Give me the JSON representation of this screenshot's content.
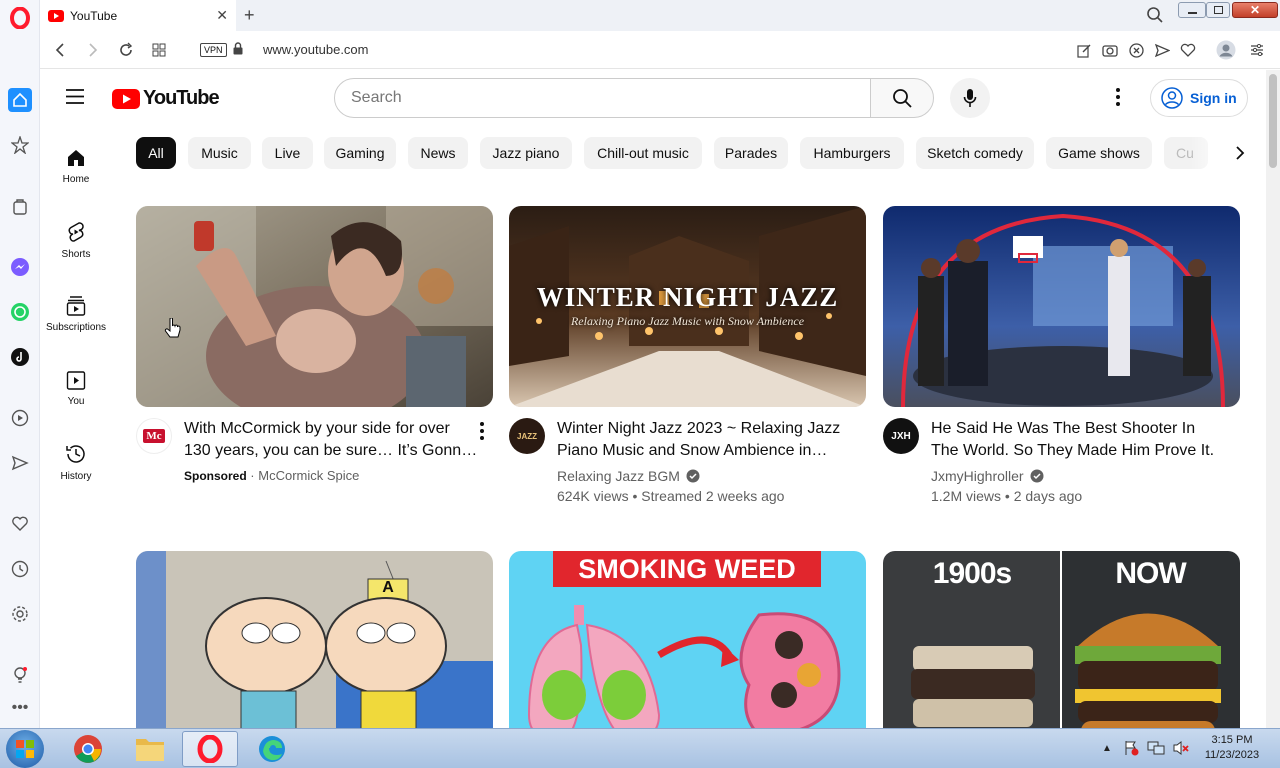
{
  "browser": {
    "tab_title": "YouTube",
    "url": "www.youtube.com",
    "vpn_label": "VPN"
  },
  "youtube": {
    "logo_text": "YouTube",
    "search_placeholder": "Search",
    "sign_in": "Sign in",
    "chips": [
      "All",
      "Music",
      "Live",
      "Gaming",
      "News",
      "Jazz piano",
      "Chill-out music",
      "Parades",
      "Hamburgers",
      "Sketch comedy",
      "Game shows",
      "Cu"
    ],
    "guide": [
      "Home",
      "Shorts",
      "Subscriptions",
      "You",
      "History"
    ],
    "videos": [
      {
        "title_1": "With McCormick by your side for over",
        "title_2": "130 years, you can be sure… It’s Gonn…",
        "sponsored": "Sponsored",
        "channel": "McCormick Spice",
        "meta": "",
        "avatar_text": "Mc"
      },
      {
        "title_1": "Winter Night Jazz 2023 ~ Relaxing Jazz",
        "title_2": "Piano Music and Snow Ambience in…",
        "channel": "Relaxing Jazz BGM",
        "meta": "624K views • Streamed 2 weeks ago",
        "thumb_title": "WINTER NIGHT JAZZ",
        "thumb_sub": "Relaxing Piano Jazz Music with Snow Ambience",
        "avatar_text": "JAZZ"
      },
      {
        "title_1": "He Said He Was The Best Shooter In",
        "title_2": "The World. So They Made Him Prove It.",
        "channel": "JxmyHighroller",
        "meta": "1.2M views • 2 days ago",
        "avatar_text": "JXH"
      },
      {
        "thumb_title": "A"
      },
      {
        "thumb_title": "SMOKING WEED"
      },
      {
        "thumb_left": "1900s",
        "thumb_right": "NOW"
      }
    ]
  },
  "taskbar": {
    "time": "3:15 PM",
    "date": "11/23/2023"
  },
  "colors": {
    "yt_red": "#ff0000",
    "signin_blue": "#065fd4",
    "opera_red": "#ff1b2d",
    "taskbar": "#b9cfe9"
  }
}
